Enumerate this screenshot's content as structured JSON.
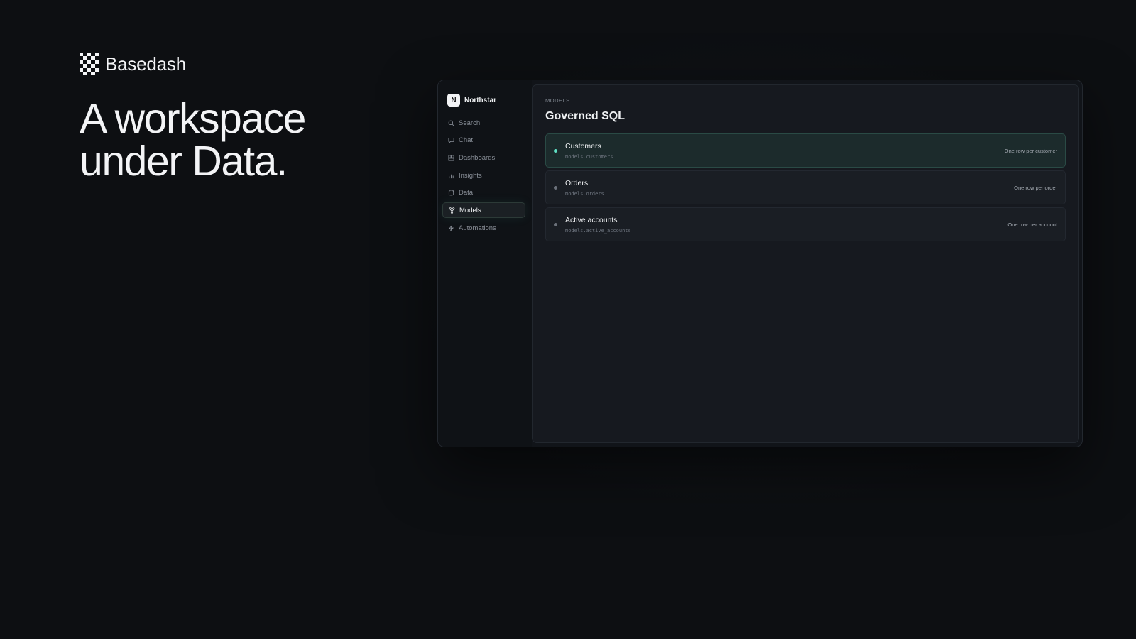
{
  "brand": {
    "name": "Basedash",
    "logo_pattern": [
      [
        1,
        0,
        1,
        0,
        1
      ],
      [
        0,
        1,
        0,
        1,
        0
      ],
      [
        1,
        0,
        1,
        0,
        1
      ],
      [
        0,
        1,
        0,
        1,
        0
      ],
      [
        1,
        0,
        1,
        0,
        1
      ],
      [
        0,
        1,
        0,
        1,
        0
      ]
    ]
  },
  "headline": {
    "line1": "A workspace",
    "line2": "under Data."
  },
  "app": {
    "workspace": {
      "initial": "N",
      "name": "Northstar"
    },
    "nav": [
      {
        "label": "Search",
        "icon": "search-icon",
        "active": false
      },
      {
        "label": "Chat",
        "icon": "chat-icon",
        "active": false
      },
      {
        "label": "Dashboards",
        "icon": "dashboard-icon",
        "active": false
      },
      {
        "label": "Insights",
        "icon": "insights-icon",
        "active": false
      },
      {
        "label": "Data",
        "icon": "database-icon",
        "active": false
      },
      {
        "label": "Models",
        "icon": "models-icon",
        "active": true
      },
      {
        "label": "Automations",
        "icon": "bolt-icon",
        "active": false
      }
    ],
    "main": {
      "section_label": "MODELS",
      "title": "Governed SQL",
      "models": [
        {
          "name": "Customers",
          "path": "models.customers",
          "grain": "One row per customer",
          "selected": true
        },
        {
          "name": "Orders",
          "path": "models.orders",
          "grain": "One row per order",
          "selected": false
        },
        {
          "name": "Active accounts",
          "path": "models.active_accounts",
          "grain": "One row per account",
          "selected": false
        }
      ]
    }
  },
  "colors": {
    "background": "#0d0f12",
    "accent": "#5fe0c4",
    "selected_row": "#1c2b2c"
  }
}
